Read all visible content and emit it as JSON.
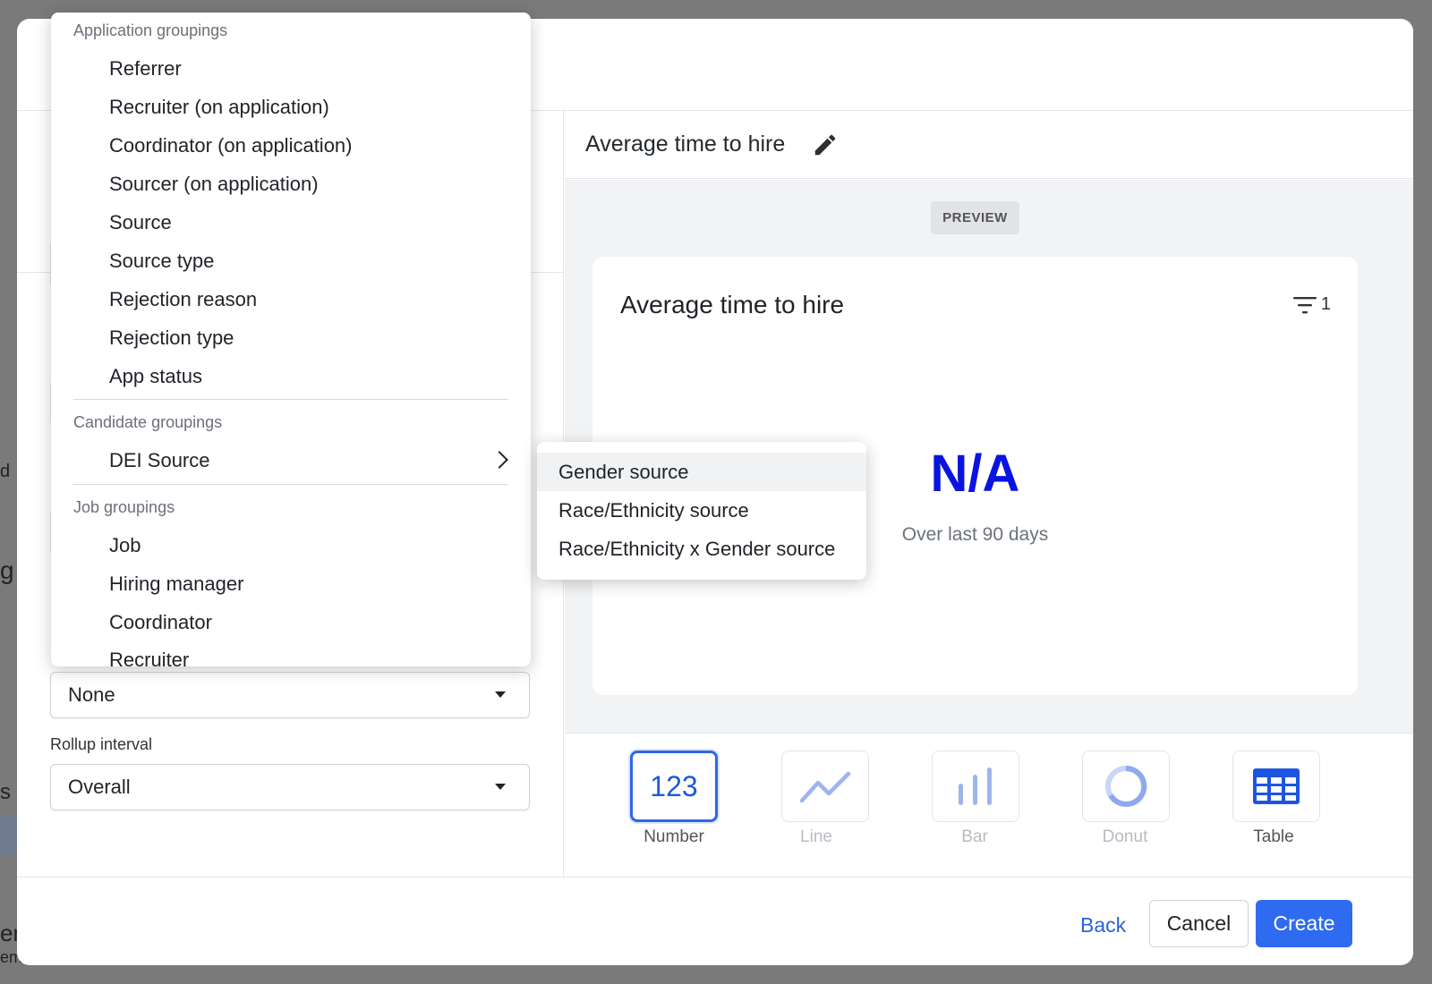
{
  "background": {
    "frag_e": "e",
    "frag_d": "d",
    "frag_g": "g",
    "frag_s": "s",
    "frag_em": "em",
    "frag_demo": "emo-..."
  },
  "modal": {
    "chart_title": "Average time to hire",
    "preview_tag": "PREVIEW",
    "card": {
      "title": "Average time to hire",
      "filter_count": "1",
      "value": "N/A",
      "subtext": "Over last 90 days"
    },
    "visualizations": [
      {
        "label": "Number",
        "icon": "number-123-icon",
        "glyph": "123",
        "selected": true
      },
      {
        "label": "Line",
        "icon": "line-chart-icon",
        "selected": false
      },
      {
        "label": "Bar",
        "icon": "bar-chart-icon",
        "selected": false
      },
      {
        "label": "Donut",
        "icon": "donut-chart-icon",
        "selected": false
      },
      {
        "label": "Table",
        "icon": "table-icon",
        "selected": false
      }
    ],
    "grouping_select": {
      "value": "None"
    },
    "rollup": {
      "label": "Rollup interval",
      "value": "Overall"
    },
    "footer": {
      "back": "Back",
      "cancel": "Cancel",
      "create": "Create"
    }
  },
  "menu": {
    "app_group_label": "Application groupings",
    "app_items": [
      "Referrer",
      "Recruiter (on application)",
      "Coordinator (on application)",
      "Sourcer (on application)",
      "Source",
      "Source type",
      "Rejection reason",
      "Rejection type",
      "App status"
    ],
    "candidate_group_label": "Candidate groupings",
    "candidate_items": [
      "DEI Source"
    ],
    "job_group_label": "Job groupings",
    "job_items": [
      "Job",
      "Hiring manager",
      "Coordinator",
      "Recruiter"
    ]
  },
  "submenu": {
    "items": [
      "Gender source",
      "Race/Ethnicity source",
      "Race/Ethnicity x Gender source"
    ],
    "highlighted": "Gender source"
  },
  "colors": {
    "accent": "#2f6bf0",
    "value_blue": "#0a14e0",
    "viz_icon": "#2f66e6",
    "viz_icon_dim": "#9db4ee"
  }
}
